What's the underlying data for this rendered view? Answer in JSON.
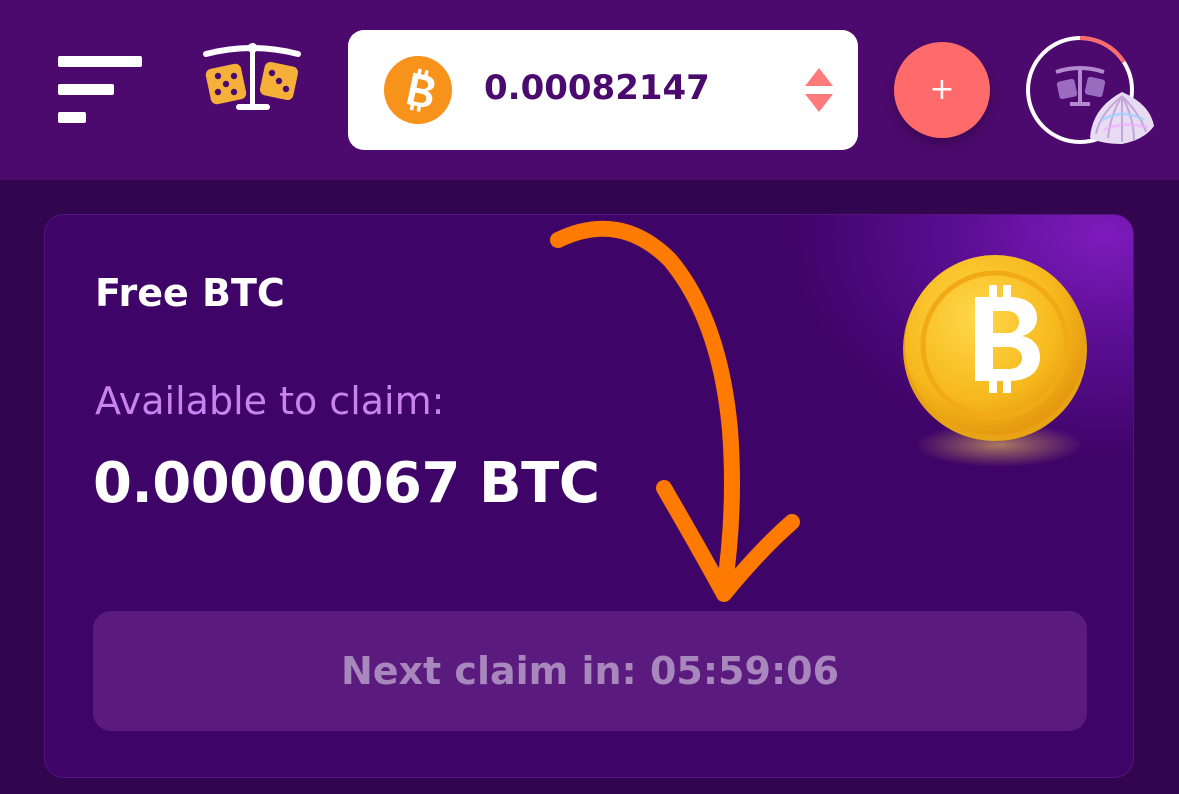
{
  "header": {
    "menu_icon": "hamburger-menu-icon",
    "logo_icon": "dice-scale-logo-icon",
    "wallet": {
      "currency_icon": "bitcoin-icon",
      "balance": "0.00082147",
      "toggle_icon": "up-down-arrows-icon"
    },
    "deposit_label": "+",
    "avatar_icon": "avatar-shell-icon"
  },
  "faucet": {
    "title": "Free BTC",
    "available_label": "Available to claim:",
    "available_amount": "0.00000067 BTC",
    "coin_icon": "bitcoin-coin-icon",
    "claim_button": "Next claim in: 05:59:06"
  },
  "annotation": {
    "arrow_icon": "hand-drawn-arrow-icon",
    "color": "#ff7a00"
  },
  "colors": {
    "header_bg": "#4d0a6e",
    "page_bg": "#32064f",
    "accent_coral": "#ff6b6b",
    "bitcoin_orange": "#f7931a",
    "label_purple": "#c983ef"
  }
}
